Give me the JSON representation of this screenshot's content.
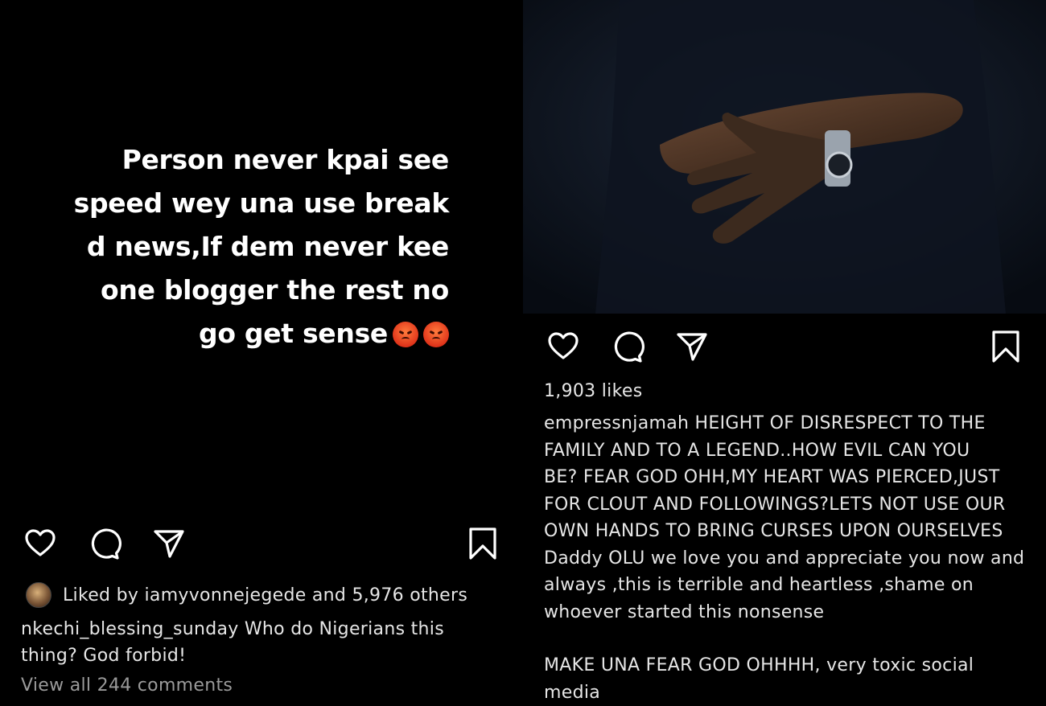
{
  "left_post": {
    "story_lines": [
      "Person never kpai see",
      "speed wey una use break",
      "d news,If dem never kee",
      "one blogger the rest no",
      "go get sense"
    ],
    "emoji_icons": [
      "angry-face-icon",
      "angry-face-icon"
    ],
    "liked_by": "Liked by iamyvonnejegede and 5,976 others",
    "caption_lines": [
      "nkechi_blessing_sunday Who do Nigerians this",
      "thing? God forbid!"
    ],
    "view_all_comments": "View all 244 comments"
  },
  "right_post": {
    "likes": "1,903 likes",
    "caption_lines": [
      "empressnjamah HEIGHT OF DISRESPECT TO THE",
      "FAMILY AND TO A LEGEND..HOW EVIL CAN YOU",
      "BE? FEAR GOD OHH,MY HEART WAS PIERCED,JUST",
      "FOR CLOUT AND FOLLOWINGS?LETS NOT USE OUR",
      "OWN HANDS TO BRING CURSES UPON OURSELVES",
      "Daddy OLU we love you and appreciate you now and",
      "always ,this is terrible and heartless ,shame on",
      "whoever started this nonsense"
    ],
    "caption_lines_2": [
      "MAKE UNA FEAR GOD OHHHH, very toxic social",
      "media"
    ]
  },
  "icons": {
    "like": "heart-icon",
    "comment": "comment-bubble-icon",
    "share": "paper-plane-icon",
    "save": "bookmark-icon"
  },
  "colors": {
    "background": "#000000",
    "text": "#ffffff",
    "muted": "#9a9a9a"
  }
}
